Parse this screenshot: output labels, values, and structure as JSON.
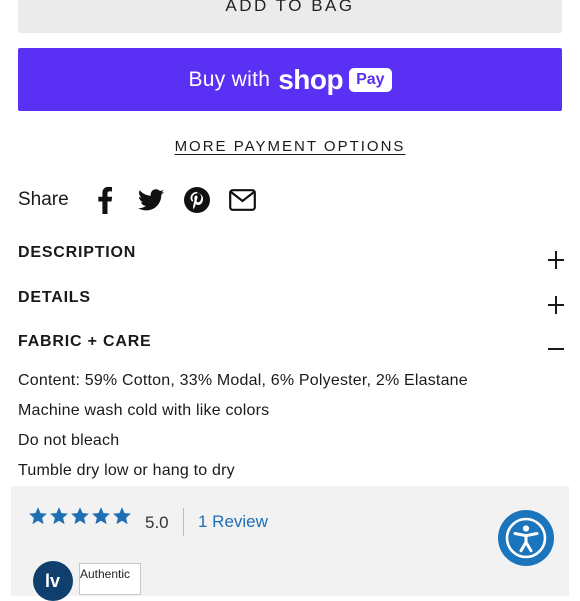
{
  "add_to_bag": {
    "label": "ADD TO BAG"
  },
  "shop_pay": {
    "buy_with": "Buy with",
    "shop": "shop",
    "pay": "Pay",
    "color": "#5a31f4"
  },
  "more_payment_options": "MORE PAYMENT OPTIONS",
  "share": {
    "label": "Share",
    "icons": [
      "facebook-icon",
      "twitter-icon",
      "pinterest-icon",
      "email-icon"
    ]
  },
  "accordion": [
    {
      "title": "DESCRIPTION",
      "state": "collapsed",
      "toggle": "+"
    },
    {
      "title": "DETAILS",
      "state": "collapsed",
      "toggle": "+"
    },
    {
      "title": "FABRIC + CARE",
      "state": "expanded",
      "toggle": "−"
    }
  ],
  "fabric_care": {
    "lines": [
      "Content: 59% Cotton, 33% Modal, 6% Polyester, 2% Elastane",
      "Machine wash cold with like colors",
      "Do not bleach",
      "Tumble dry low or hang to dry"
    ]
  },
  "reviews": {
    "stars_filled": 5,
    "stars_total": 5,
    "rating": "5.0",
    "review_link": "1 Review",
    "star_color": "#1f6fb5",
    "authentic_badge": "Authentic"
  },
  "accessibility": {
    "icon": "accessibility-icon",
    "color": "#1b75bc"
  }
}
